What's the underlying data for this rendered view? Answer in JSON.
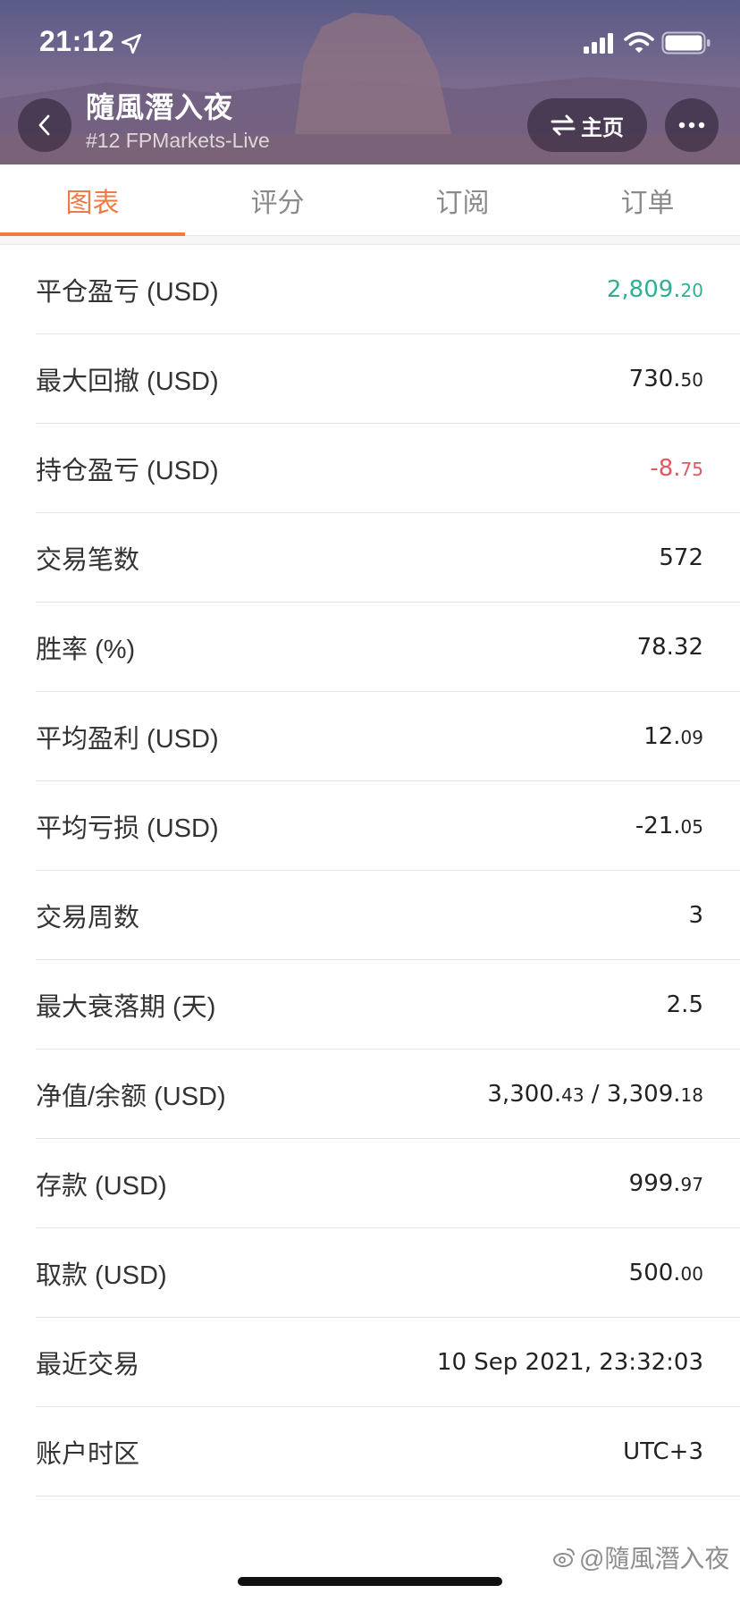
{
  "status_bar": {
    "time": "21:12",
    "icons": [
      "location-arrow-icon",
      "cellular-signal-icon",
      "wifi-icon",
      "battery-icon"
    ]
  },
  "header": {
    "title": "隨風潛入夜",
    "subtitle": "#12 FPMarkets-Live",
    "home_label": "主页",
    "icons": [
      "back-chevron-icon",
      "swap-arrows-icon",
      "more-dots-icon"
    ]
  },
  "tabs": [
    {
      "label": "图表",
      "active": true
    },
    {
      "label": "评分",
      "active": false
    },
    {
      "label": "订阅",
      "active": false
    },
    {
      "label": "订单",
      "active": false
    }
  ],
  "stats": [
    {
      "label": "平仓盈亏 (USD)",
      "int": "2,809.",
      "dec": "20",
      "tone": "positive"
    },
    {
      "label": "最大回撤 (USD)",
      "int": "730.",
      "dec": "50",
      "tone": "neutral"
    },
    {
      "label": "持仓盈亏 (USD)",
      "int": "-8.",
      "dec": "75",
      "tone": "negative"
    },
    {
      "label": "交易笔数",
      "int": "572",
      "dec": "",
      "tone": "neutral"
    },
    {
      "label": "胜率 (%)",
      "int": "78.32",
      "dec": "",
      "tone": "neutral"
    },
    {
      "label": "平均盈利 (USD)",
      "int": "12.",
      "dec": "09",
      "tone": "neutral"
    },
    {
      "label": "平均亏损 (USD)",
      "int": "-21.",
      "dec": "05",
      "tone": "neutral"
    },
    {
      "label": "交易周数",
      "int": "3",
      "dec": "",
      "tone": "neutral"
    },
    {
      "label": "最大衰落期 (天)",
      "int": "2.5",
      "dec": "",
      "tone": "neutral"
    },
    {
      "label": "净值/余额 (USD)",
      "int": "3,300.",
      "dec": "43",
      "int2": " / 3,309.",
      "dec2": "18",
      "tone": "neutral"
    },
    {
      "label": "存款 (USD)",
      "int": "999.",
      "dec": "97",
      "tone": "neutral"
    },
    {
      "label": "取款 (USD)",
      "int": "500.",
      "dec": "00",
      "tone": "neutral"
    },
    {
      "label": "最近交易",
      "int": "10 Sep 2021, 23:32:03",
      "dec": "",
      "tone": "neutral"
    },
    {
      "label": "账户时区",
      "int": "UTC+3",
      "dec": "",
      "tone": "neutral"
    }
  ],
  "watermark": "@隨風潛入夜",
  "colors": {
    "accent": "#f07a43",
    "positive": "#2fb094",
    "negative": "#e05762"
  }
}
